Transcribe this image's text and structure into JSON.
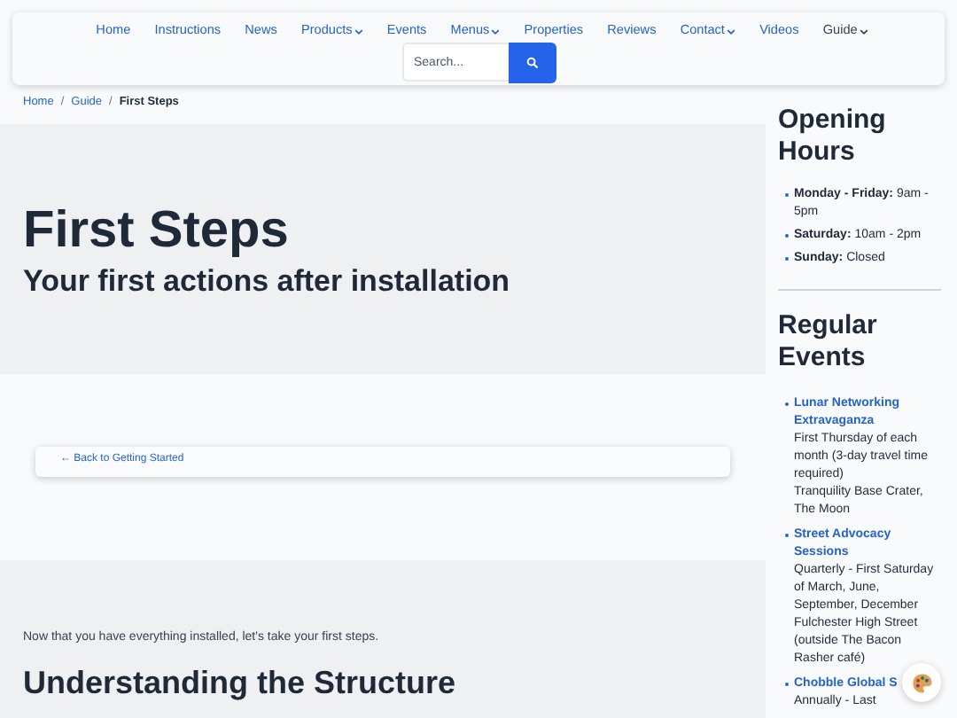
{
  "nav": {
    "items": [
      {
        "label": "Home",
        "dropdown": false,
        "selected": false
      },
      {
        "label": "Instructions",
        "dropdown": false,
        "selected": false
      },
      {
        "label": "News",
        "dropdown": false,
        "selected": false
      },
      {
        "label": "Products",
        "dropdown": true,
        "selected": false
      },
      {
        "label": "Events",
        "dropdown": false,
        "selected": false
      },
      {
        "label": "Menus",
        "dropdown": true,
        "selected": false
      },
      {
        "label": "Properties",
        "dropdown": false,
        "selected": false
      },
      {
        "label": "Reviews",
        "dropdown": false,
        "selected": false
      },
      {
        "label": "Contact",
        "dropdown": true,
        "selected": false
      },
      {
        "label": "Videos",
        "dropdown": false,
        "selected": false
      },
      {
        "label": "Guide",
        "dropdown": true,
        "selected": true
      }
    ],
    "search": {
      "placeholder": "Search..."
    }
  },
  "breadcrumb": {
    "separator": "/",
    "items": [
      {
        "label": "Home",
        "current": false
      },
      {
        "label": "Guide",
        "current": false
      },
      {
        "label": "First Steps",
        "current": true
      }
    ]
  },
  "hero": {
    "title": "First Steps",
    "subtitle": "Your first actions after installation"
  },
  "back_link": "← Back to Getting Started",
  "content": {
    "intro": "Now that you have everything installed, let's take your first steps.",
    "heading": "Understanding the Structure"
  },
  "sidebar": {
    "opening_hours": {
      "title": "Opening Hours",
      "items": [
        "**Monday - Friday:** 9am - 5pm",
        "**Saturday:** 10am - 2pm",
        "**Sunday:** Closed"
      ]
    },
    "events": {
      "title": "Regular Events",
      "items": [
        {
          "name": "Lunar Networking Extravaganza",
          "lines": [
            "First Thursday of each month (3-day travel time required)",
            "Tranquility Base Crater, The Moon"
          ]
        },
        {
          "name": "Street Advocacy Sessions",
          "lines": [
            "Quarterly - First Saturday of March, June, September, December",
            "Fulchester High Street (outside The Bacon Rasher café)"
          ]
        },
        {
          "name": "Chobble Global S",
          "lines": [
            "Annually - Last"
          ]
        }
      ]
    }
  }
}
